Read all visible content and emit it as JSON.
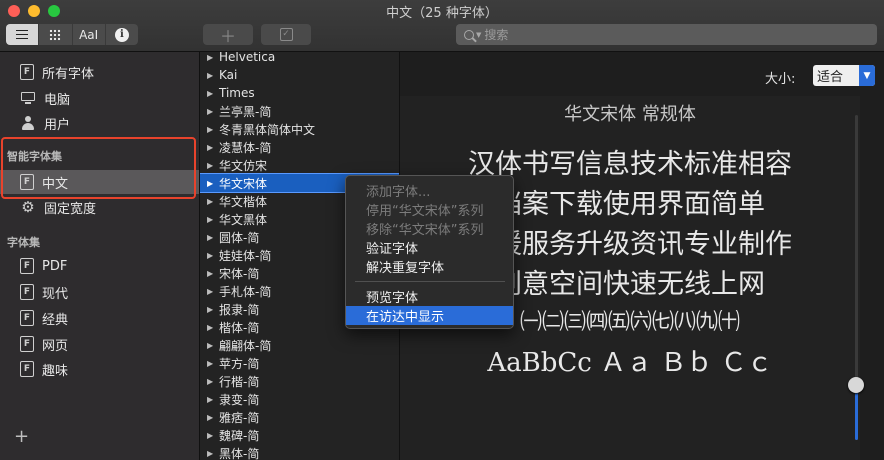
{
  "window": {
    "title": "中文（25 种字体）"
  },
  "toolbar": {
    "view_text_sample": "AaI",
    "info_glyph": "i",
    "add_glyph": "＋",
    "check_glyph": "✓",
    "search_placeholder": "搜索"
  },
  "sidebar": {
    "items": [
      {
        "label": "所有字体",
        "icon": "font-book-icon"
      },
      {
        "label": "电脑",
        "icon": "computer-icon"
      },
      {
        "label": "用户",
        "icon": "user-icon"
      }
    ],
    "smart_heading": "智能字体集",
    "smart_items": [
      {
        "label": "中文",
        "icon": "font-book-icon",
        "selected": true
      },
      {
        "label": "固定宽度",
        "icon": "gear-icon"
      }
    ],
    "collections_heading": "字体集",
    "collections": [
      {
        "label": "PDF"
      },
      {
        "label": "现代"
      },
      {
        "label": "经典"
      },
      {
        "label": "网页"
      },
      {
        "label": "趣味"
      }
    ],
    "add_glyph": "+",
    "font_icon_glyph": "F"
  },
  "font_list": {
    "items": [
      "Helvetica",
      "Kai",
      "Times",
      "兰亭黑-简",
      "冬青黑体简体中文",
      "凌慧体-简",
      "华文仿宋",
      "华文宋体",
      "华文楷体",
      "华文黑体",
      "圆体-简",
      "娃娃体-简",
      "宋体-简",
      "手札体-简",
      "报隶-简",
      "楷体-简",
      "翩翩体-简",
      "苹方-简",
      "行楷-简",
      "隶变-简",
      "雅痞-简",
      "魏碑-简",
      "黑体-简"
    ],
    "selected_index": 7,
    "triangle_glyph": "▶"
  },
  "context_menu": {
    "items": [
      {
        "label": "添加字体...",
        "enabled": false
      },
      {
        "label": "停用“华文宋体”系列",
        "enabled": false
      },
      {
        "label": "移除“华文宋体”系列",
        "enabled": false
      },
      {
        "label": "验证字体",
        "enabled": true
      },
      {
        "label": "解决重复字体",
        "enabled": true
      },
      {
        "label": "预览字体",
        "enabled": true
      },
      {
        "label": "在访达中显示",
        "enabled": true,
        "highlighted": true
      }
    ]
  },
  "preview": {
    "size_label": "大小:",
    "size_value": "适合",
    "font_title": "华文宋体 常规体",
    "lines": [
      "汉体书写信息技术标准相容",
      "档案下载使用界面简单",
      "支援服务升级资讯专业制作",
      "创意空间快速无线上网",
      "㈠㈡㈢㈣㈤㈥㈦㈧㈨㈩",
      "AaBbCc Ａａ Ｂｂ Ｃｃ"
    ]
  },
  "colors": {
    "accent": "#2a6cd8",
    "selection": "#1a5fbf",
    "annotation_box": "#e8432c"
  }
}
